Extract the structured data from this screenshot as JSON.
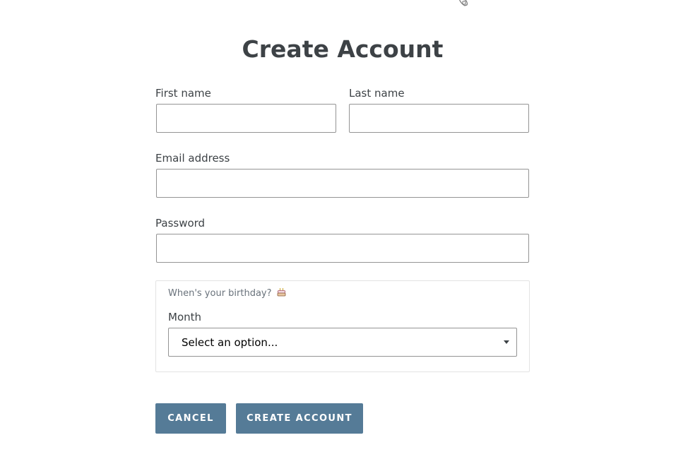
{
  "header": {
    "icon": "cursor-hand-icon"
  },
  "form": {
    "title": "Create Account",
    "first_name": {
      "label": "First name",
      "value": "",
      "placeholder": ""
    },
    "last_name": {
      "label": "Last name",
      "value": "",
      "placeholder": ""
    },
    "email": {
      "label": "Email address",
      "value": "",
      "placeholder": ""
    },
    "password": {
      "label": "Password",
      "value": "",
      "placeholder": ""
    },
    "birthday": {
      "legend": "When's your birthday?",
      "legend_icon": "birthday-cake-icon",
      "month": {
        "label": "Month",
        "selected": "Select an option..."
      }
    },
    "buttons": {
      "cancel_label": "CANCEL",
      "create_label": "CREATE ACCOUNT",
      "color": "#557b97"
    }
  }
}
